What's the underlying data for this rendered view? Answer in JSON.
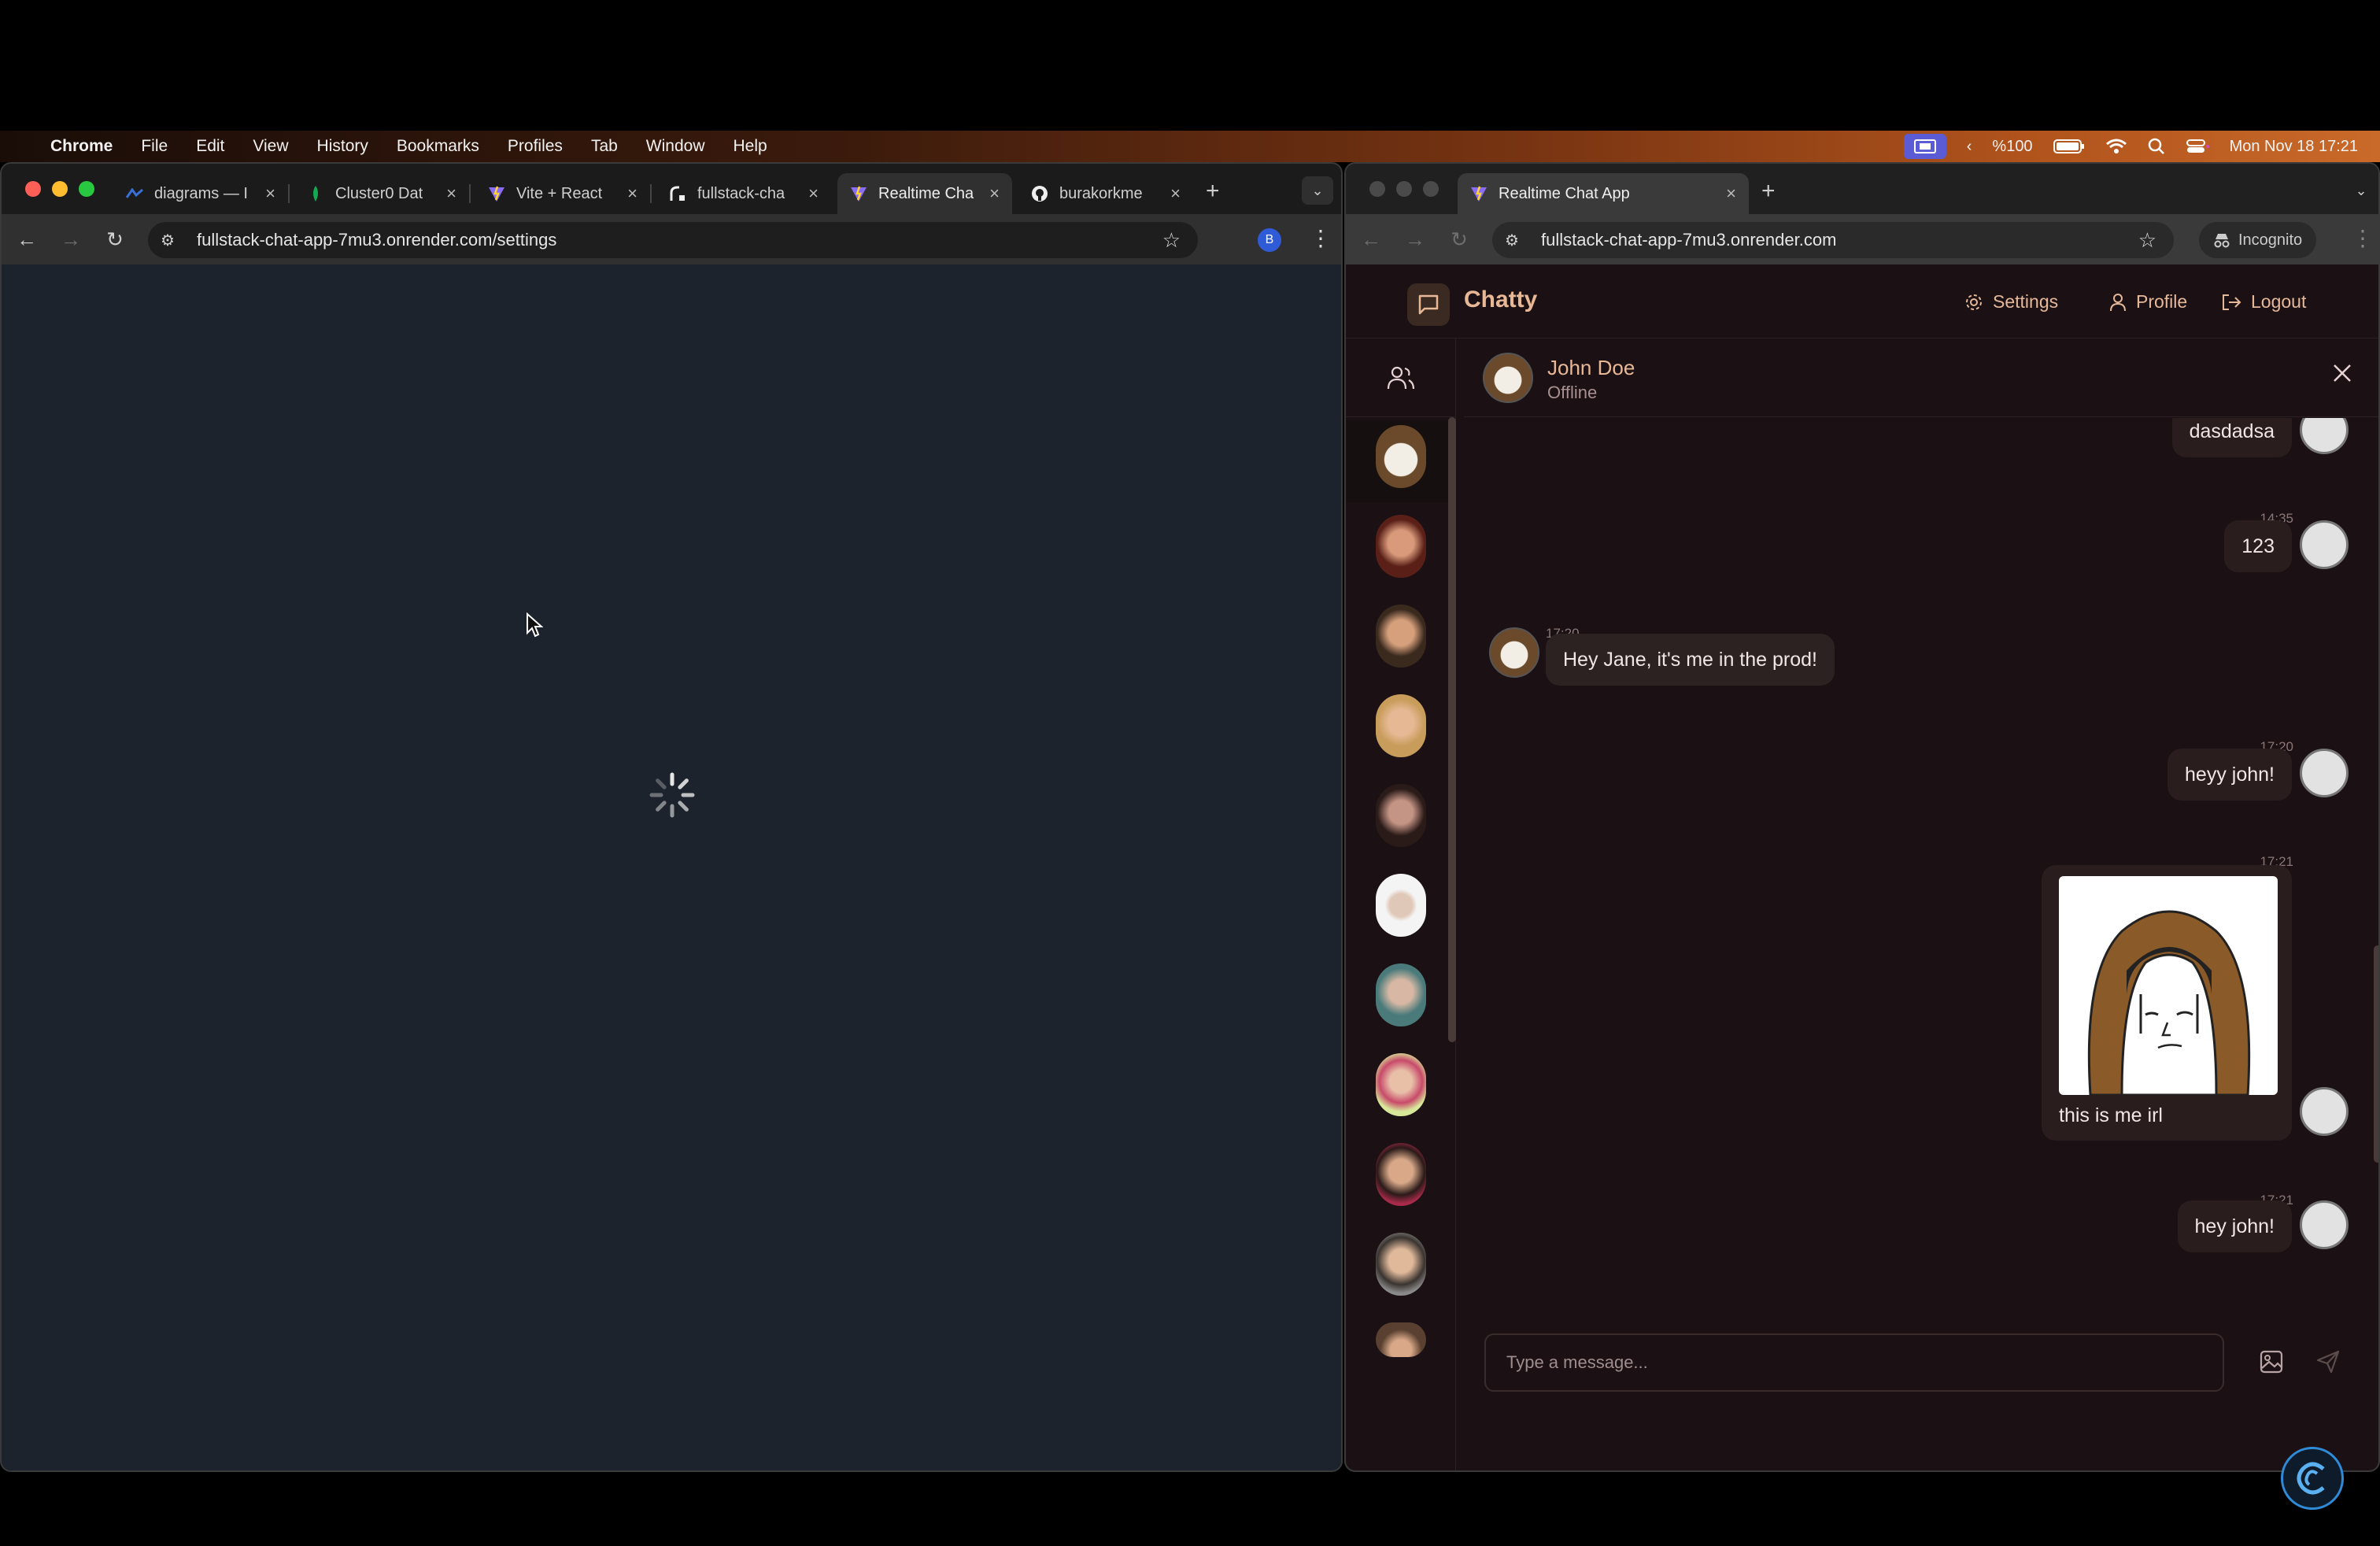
{
  "menubar": {
    "app_name": "Chrome",
    "items": [
      "File",
      "Edit",
      "View",
      "History",
      "Bookmarks",
      "Profiles",
      "Tab",
      "Window",
      "Help"
    ],
    "battery": "%100",
    "datetime": "Mon Nov 18  17:21"
  },
  "left_window": {
    "tabs": [
      {
        "label": "diagrams — I",
        "icon": "diagrams-icon"
      },
      {
        "label": "Cluster0 Dat",
        "icon": "mongodb-leaf-icon"
      },
      {
        "label": "Vite + React",
        "icon": "vite-icon"
      },
      {
        "label": "fullstack-cha",
        "icon": "render-icon"
      },
      {
        "label": "Realtime Cha",
        "icon": "vite-icon"
      },
      {
        "label": "burakorkme",
        "icon": "github-icon"
      }
    ],
    "url": "fullstack-chat-app-7mu3.onrender.com/settings",
    "profile_initial": "B"
  },
  "right_window": {
    "tab_label": "Realtime Chat App",
    "url": "fullstack-chat-app-7mu3.onrender.com",
    "incognito_label": "Incognito"
  },
  "app": {
    "brand": "Chatty",
    "nav": {
      "settings": "Settings",
      "profile": "Profile",
      "logout": "Logout"
    },
    "chat_header": {
      "name": "John Doe",
      "status": "Offline"
    },
    "messages": [
      {
        "from": "me",
        "text": "dasdadsa"
      },
      {
        "from": "me",
        "time": "14:35",
        "text": "123"
      },
      {
        "from": "them",
        "time": "17:20",
        "text": "Hey Jane, it's me in the prod!"
      },
      {
        "from": "me",
        "time": "17:20",
        "text": "heyy john!"
      },
      {
        "from": "me",
        "time": "17:21",
        "text": "this is me irl",
        "has_image": true
      },
      {
        "from": "me",
        "time": "17:21",
        "text": "hey john!"
      }
    ],
    "input_placeholder": "Type a message..."
  },
  "colors": {
    "accent": "#e8b896",
    "app_bg": "#1b1114",
    "loading_bg": "#1d232c"
  }
}
